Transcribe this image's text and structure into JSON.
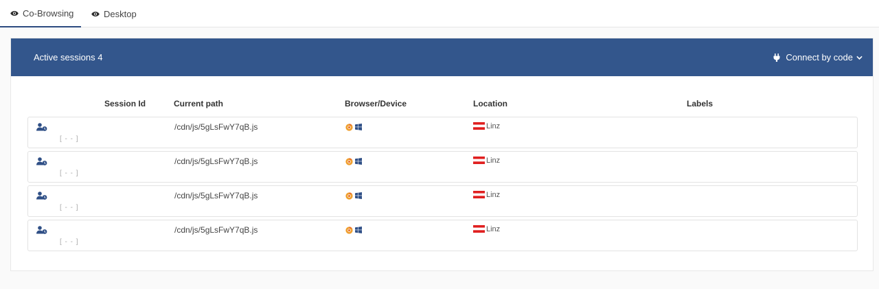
{
  "tabs": [
    {
      "label": "Co-Browsing",
      "icon": "eye-icon",
      "active": true
    },
    {
      "label": "Desktop",
      "icon": "eye-icon",
      "active": false
    }
  ],
  "panel": {
    "title": "Active sessions 4",
    "connect_label": "Connect by code",
    "header_color": "#33568c"
  },
  "columns": {
    "session_id": "Session Id",
    "current_path": "Current path",
    "browser_device": "Browser/Device",
    "location": "Location",
    "labels": "Labels"
  },
  "sessions": [
    {
      "session_id": "[ - - ]",
      "path": "/cdn/js/5gLsFwY7qB.js",
      "browser": "chrome-icon",
      "device": "windows-icon",
      "flag": "austria-flag-icon",
      "location": "Linz",
      "labels": ""
    },
    {
      "session_id": "[ - - ]",
      "path": "/cdn/js/5gLsFwY7qB.js",
      "browser": "chrome-icon",
      "device": "windows-icon",
      "flag": "austria-flag-icon",
      "location": "Linz",
      "labels": ""
    },
    {
      "session_id": "[ - - ]",
      "path": "/cdn/js/5gLsFwY7qB.js",
      "browser": "chrome-icon",
      "device": "windows-icon",
      "flag": "austria-flag-icon",
      "location": "Linz",
      "labels": ""
    },
    {
      "session_id": "[ - - ]",
      "path": "/cdn/js/5gLsFwY7qB.js",
      "browser": "chrome-icon",
      "device": "windows-icon",
      "flag": "austria-flag-icon",
      "location": "Linz",
      "labels": ""
    }
  ]
}
